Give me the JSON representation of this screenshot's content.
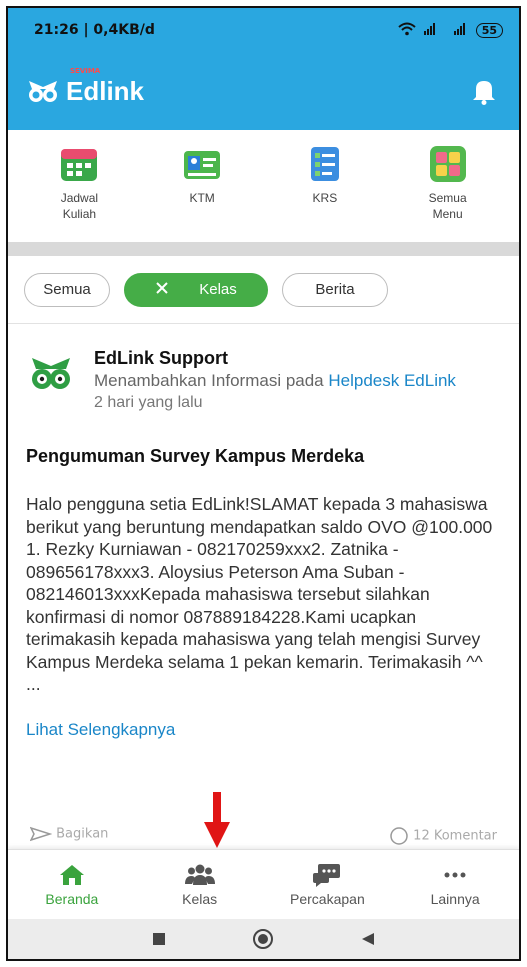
{
  "status_bar": {
    "time_data": "21:26 | 0,4KB/d",
    "battery": "55"
  },
  "app_bar": {
    "brand_sub": "SEVIMA",
    "brand_name": "Edlink",
    "bell_icon": "bell-icon"
  },
  "quick_menu": [
    {
      "label": "Jadwal\nKuliah",
      "icon": "calendar-icon"
    },
    {
      "label": "KTM",
      "icon": "id-card-icon"
    },
    {
      "label": "KRS",
      "icon": "checklist-icon"
    },
    {
      "label": "Semua\nMenu",
      "icon": "grid-icon"
    }
  ],
  "filters": {
    "all": "Semua",
    "active": "Kelas",
    "news": "Berita"
  },
  "post": {
    "author": "EdLink Support",
    "action_prefix": "Menambahkan Informasi pada ",
    "action_link": "Helpdesk EdLink",
    "time": "2 hari yang lalu",
    "title": "Pengumuman Survey Kampus Merdeka",
    "body": "Halo pengguna setia EdLink!SLAMAT kepada 3 mahasiswa berikut yang beruntung mendapatkan saldo OVO @100.000 1. Rezky Kurniawan - 082170259xxx2. Zatnika - 089656178xxx3. Aloysius Peterson Ama Suban - 082146013xxxKepada mahasiswa tersebut silahkan konfirmasi di nomor 087889184228.Kami ucapkan terimakasih kepada mahasiswa yang telah mengisi Survey Kampus Merdeka selama 1 pekan kemarin. Terimakasih ^^ ...",
    "read_more": "Lihat Selengkapnya",
    "share_partial": "Bagikan",
    "comments_partial": "12 Komentar"
  },
  "bottom_nav": [
    {
      "label": "Beranda",
      "icon": "home-icon",
      "active": true
    },
    {
      "label": "Kelas",
      "icon": "group-icon",
      "active": false
    },
    {
      "label": "Percakapan",
      "icon": "chat-icon",
      "active": false
    },
    {
      "label": "Lainnya",
      "icon": "more-icon",
      "active": false
    }
  ],
  "colors": {
    "primary": "#2aa7e0",
    "accent_green": "#45ad47",
    "link": "#1a86c8",
    "arrow": "#e01515"
  }
}
